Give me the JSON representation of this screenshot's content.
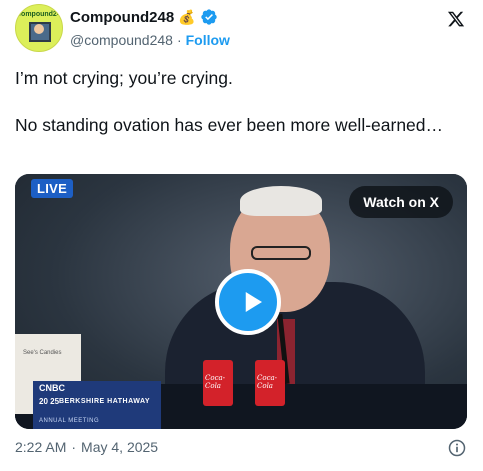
{
  "author": {
    "display_name": "Compound248",
    "emoji": "💰",
    "handle": "@compound248",
    "separator": "·",
    "follow_label": "Follow",
    "avatar_text": "Compound248",
    "avatar_icon": "avatar-illustration"
  },
  "tweet": {
    "line1": "I’m not crying; you’re crying.",
    "line2": "No standing ovation has ever been more well-earned…"
  },
  "media": {
    "live_label": "LIVE",
    "watch_label": "Watch on X",
    "sign_text": "See's Candies",
    "can_label": "Coca-Cola",
    "overlay": {
      "network": "CNBC",
      "year": "20 25",
      "event_name": "BERKSHIRE HATHAWAY",
      "event_sub": "ANNUAL MEETING"
    }
  },
  "footer": {
    "time": "2:22 AM",
    "separator": "·",
    "date": "May 4, 2025"
  },
  "colors": {
    "accent": "#1d9bf0",
    "text": "#0f1419",
    "muted": "#536471",
    "live_badge": "#1d5fc5"
  }
}
